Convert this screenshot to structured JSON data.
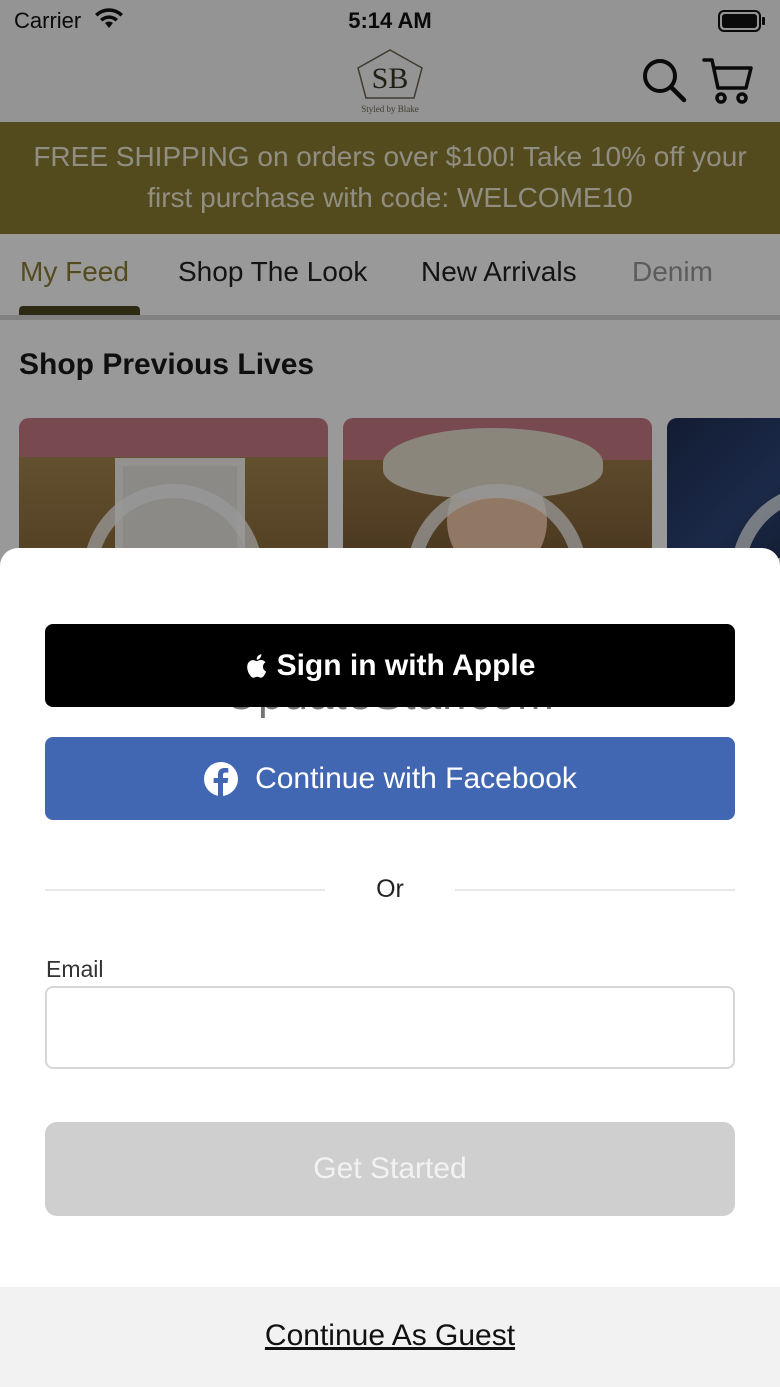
{
  "status_bar": {
    "carrier": "Carrier",
    "time": "5:14 AM"
  },
  "header": {
    "logo_monogram": "SB",
    "logo_text": "Styled by Blake",
    "search_icon": "search-icon",
    "cart_icon": "cart-icon"
  },
  "promo": {
    "line1": "FREE SHIPPING on orders over $100! Take 10% off your",
    "line2": "first purchase with code: WELCOME10",
    "background": "#8b7d32"
  },
  "tabs": [
    {
      "label": "My Feed",
      "active": true
    },
    {
      "label": "Shop The Look",
      "active": false
    },
    {
      "label": "New Arrivals",
      "active": false
    },
    {
      "label": "Denim",
      "active": false
    }
  ],
  "section": {
    "title": "Shop Previous Lives"
  },
  "sheet": {
    "apple_button": "Sign in with Apple",
    "facebook_button": "Continue with Facebook",
    "watermark": "UpdateStar.com",
    "or_label": "Or",
    "email_label": "Email",
    "email_value": "",
    "email_placeholder": "",
    "get_started_button": "Get Started",
    "guest_link": "Continue As Guest"
  },
  "colors": {
    "accent": "#8b7d32",
    "facebook": "#4267b2",
    "apple": "#000000",
    "disabled_button": "#cfcfcf"
  }
}
